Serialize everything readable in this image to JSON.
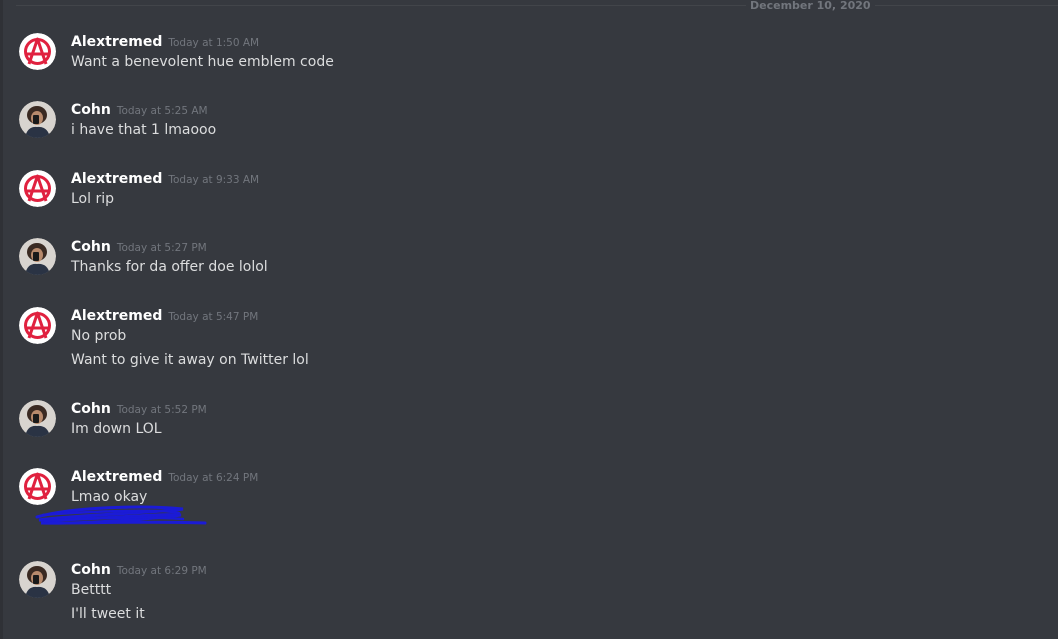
{
  "date_divider": "December 10, 2020",
  "messages": [
    {
      "author": "Alextremed",
      "time": "Today at 1:50 AM",
      "avatar": "anarchy-icon",
      "lines": [
        "Want a benevolent hue emblem code"
      ]
    },
    {
      "author": "Cohn",
      "time": "Today at 5:25 AM",
      "avatar": "selfie-photo",
      "lines": [
        "i have that 1 lmaooo"
      ]
    },
    {
      "author": "Alextremed",
      "time": "Today at 9:33 AM",
      "avatar": "anarchy-icon",
      "lines": [
        "Lol rip"
      ]
    },
    {
      "author": "Cohn",
      "time": "Today at 5:27 PM",
      "avatar": "selfie-photo",
      "lines": [
        "Thanks for da offer doe lolol"
      ]
    },
    {
      "author": "Alextremed",
      "time": "Today at 5:47 PM",
      "avatar": "anarchy-icon",
      "lines": [
        "No prob",
        "Want to give it away on Twitter lol"
      ]
    },
    {
      "author": "Cohn",
      "time": "Today at 5:52 PM",
      "avatar": "selfie-photo",
      "lines": [
        "Im down LOL"
      ]
    },
    {
      "author": "Alextremed",
      "time": "Today at 6:24 PM",
      "avatar": "anarchy-icon",
      "lines": [
        "Lmao okay"
      ]
    },
    {
      "author": "Cohn",
      "time": "Today at 6:29 PM",
      "avatar": "selfie-photo",
      "lines": [
        "Betttt",
        "I'll tweet it"
      ]
    }
  ],
  "colors": {
    "background": "#36393f",
    "username": "#ffffff",
    "message_text": "#dcddde",
    "timestamp": "#72767d",
    "anarchy_red": "#e0213f",
    "redaction_blue": "#1b1bd6"
  }
}
